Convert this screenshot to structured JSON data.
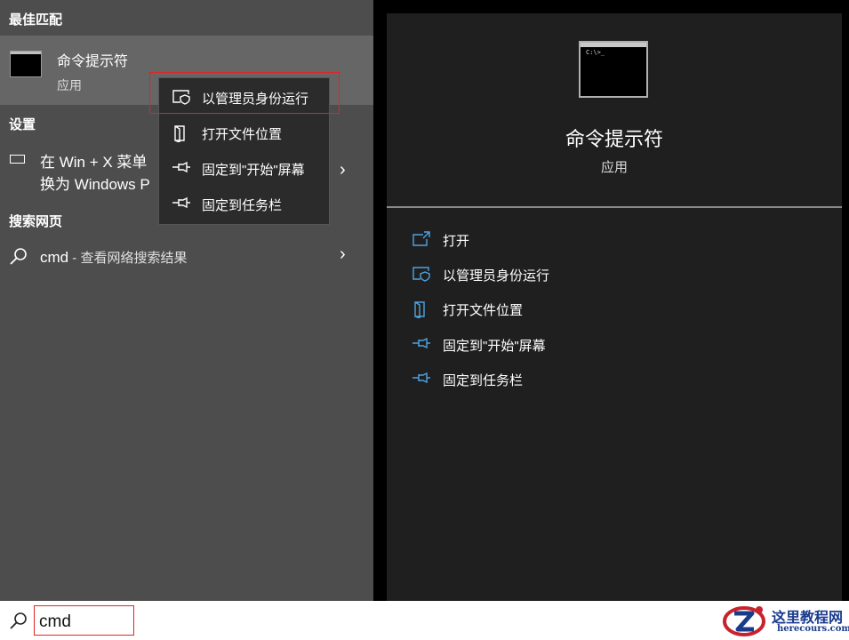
{
  "left": {
    "best_match_title": "最佳匹配",
    "best_match": {
      "name": "命令提示符",
      "type": "应用"
    },
    "settings_title": "设置",
    "setting": {
      "line1": "在 Win + X 菜单",
      "line2": "换为 Windows P"
    },
    "web_title": "搜索网页",
    "web_result": {
      "query": "cmd",
      "suffix": " - 查看网络搜索结果"
    }
  },
  "context_menu": {
    "items": [
      {
        "label": "以管理员身份运行",
        "icon": "shield-window-icon"
      },
      {
        "label": "打开文件位置",
        "icon": "folder-location-icon"
      },
      {
        "label": "固定到\"开始\"屏幕",
        "icon": "pin-icon"
      },
      {
        "label": "固定到任务栏",
        "icon": "pin-icon"
      }
    ]
  },
  "preview": {
    "name": "命令提示符",
    "type": "应用",
    "actions": [
      {
        "label": "打开",
        "icon": "open-icon"
      },
      {
        "label": "以管理员身份运行",
        "icon": "shield-window-icon"
      },
      {
        "label": "打开文件位置",
        "icon": "folder-location-icon"
      },
      {
        "label": "固定到\"开始\"屏幕",
        "icon": "pin-icon"
      },
      {
        "label": "固定到任务栏",
        "icon": "pin-icon"
      }
    ]
  },
  "taskbar": {
    "search_value": "cmd"
  },
  "watermark": {
    "name": "这里教程网",
    "url": "herecours.com"
  },
  "colors": {
    "left_bg": "#4d4d4d",
    "selected_bg": "#666666",
    "menu_bg": "#2b2b2b",
    "preview_bg": "#1f1f1f",
    "action_icon": "#4fa3e0",
    "highlight": "#e02424"
  }
}
